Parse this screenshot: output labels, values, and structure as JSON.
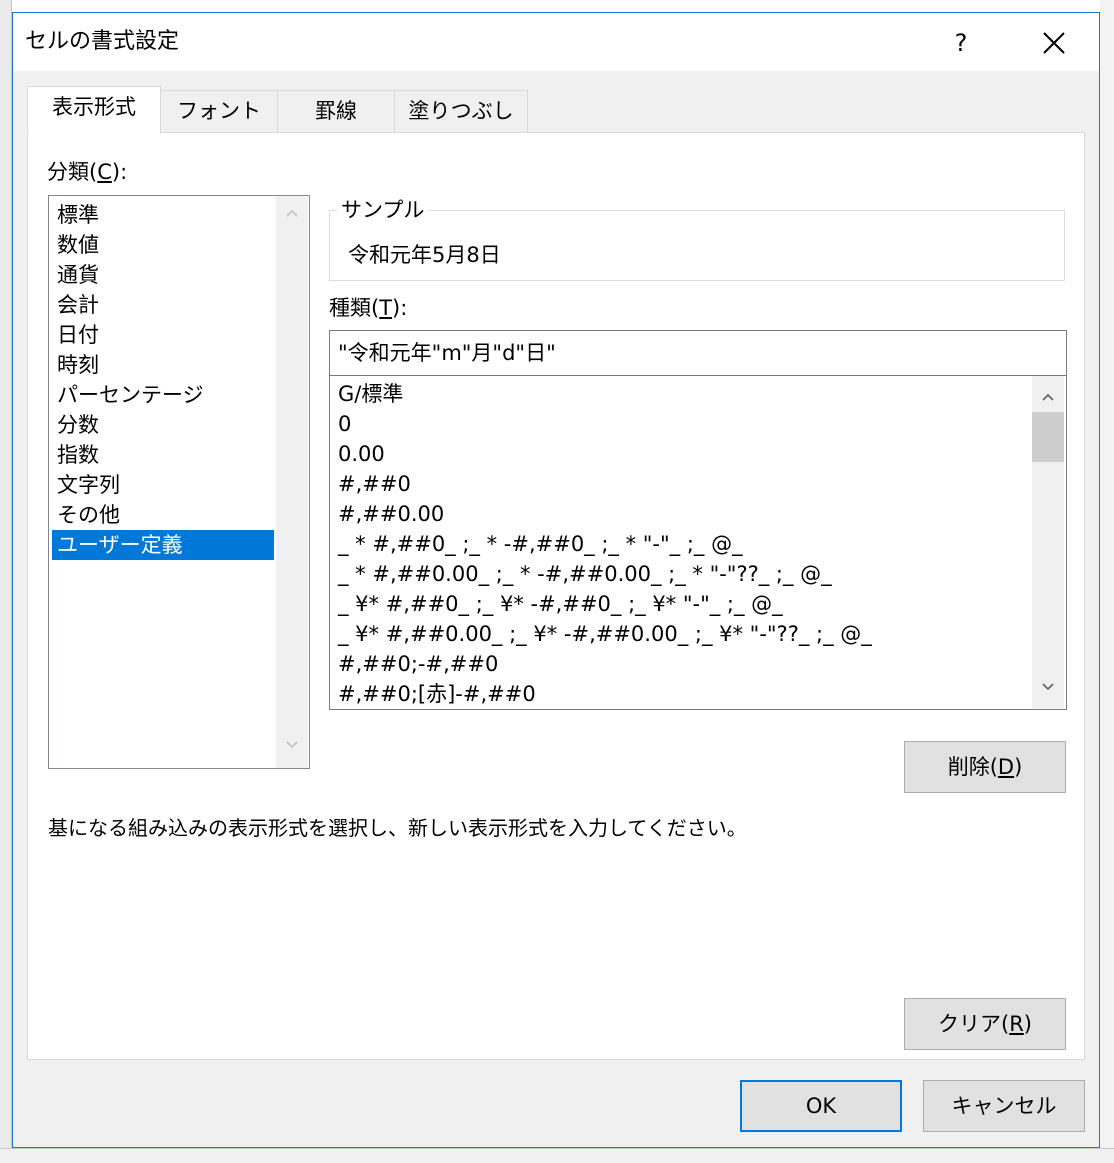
{
  "dialog": {
    "title": "セルの書式設定",
    "help_label": "?"
  },
  "tabs": [
    {
      "label": "表示形式",
      "active": true
    },
    {
      "label": "フォント",
      "active": false
    },
    {
      "label": "罫線",
      "active": false
    },
    {
      "label": "塗りつぶし",
      "active": false
    }
  ],
  "category": {
    "label_prefix": "分類(",
    "label_key": "C",
    "label_suffix": "):",
    "items": [
      "標準",
      "数値",
      "通貨",
      "会計",
      "日付",
      "時刻",
      "パーセンテージ",
      "分数",
      "指数",
      "文字列",
      "その他",
      "ユーザー定義"
    ],
    "selected": "ユーザー定義"
  },
  "sample": {
    "legend": "サンプル",
    "value": "令和元年5月8日"
  },
  "type": {
    "label_prefix": "種類(",
    "label_key": "T",
    "label_suffix": "):",
    "value": "\"令和元年\"m\"月\"d\"日\"",
    "items": [
      "G/標準",
      "0",
      "0.00",
      "#,##0",
      "#,##0.00",
      "_ * #,##0_ ;_ * -#,##0_ ;_ * \"-\"_ ;_ @_",
      "_ * #,##0.00_ ;_ * -#,##0.00_ ;_ * \"-\"??_ ;_ @_",
      "_ ¥* #,##0_ ;_ ¥* -#,##0_ ;_ ¥* \"-\"_ ;_ @_",
      "_ ¥* #,##0.00_ ;_ ¥* -#,##0.00_ ;_ ¥* \"-\"??_ ;_ @_",
      "#,##0;-#,##0",
      "#,##0;[赤]-#,##0"
    ]
  },
  "buttons": {
    "delete_prefix": "削除(",
    "delete_key": "D",
    "delete_suffix": ")",
    "clear_prefix": "クリア(",
    "clear_key": "R",
    "clear_suffix": ")",
    "ok": "OK",
    "cancel": "キャンセル"
  },
  "description": "基になる組み込みの表示形式を選択し、新しい表示形式を入力してください。",
  "icons": {
    "close": "close-icon",
    "scroll_up": "chevron-up-icon",
    "scroll_down": "chevron-down-icon"
  },
  "colors": {
    "accent": "#0078d7",
    "dialog_border": "#1e75d0",
    "dialog_bg": "#f0f0f0"
  }
}
